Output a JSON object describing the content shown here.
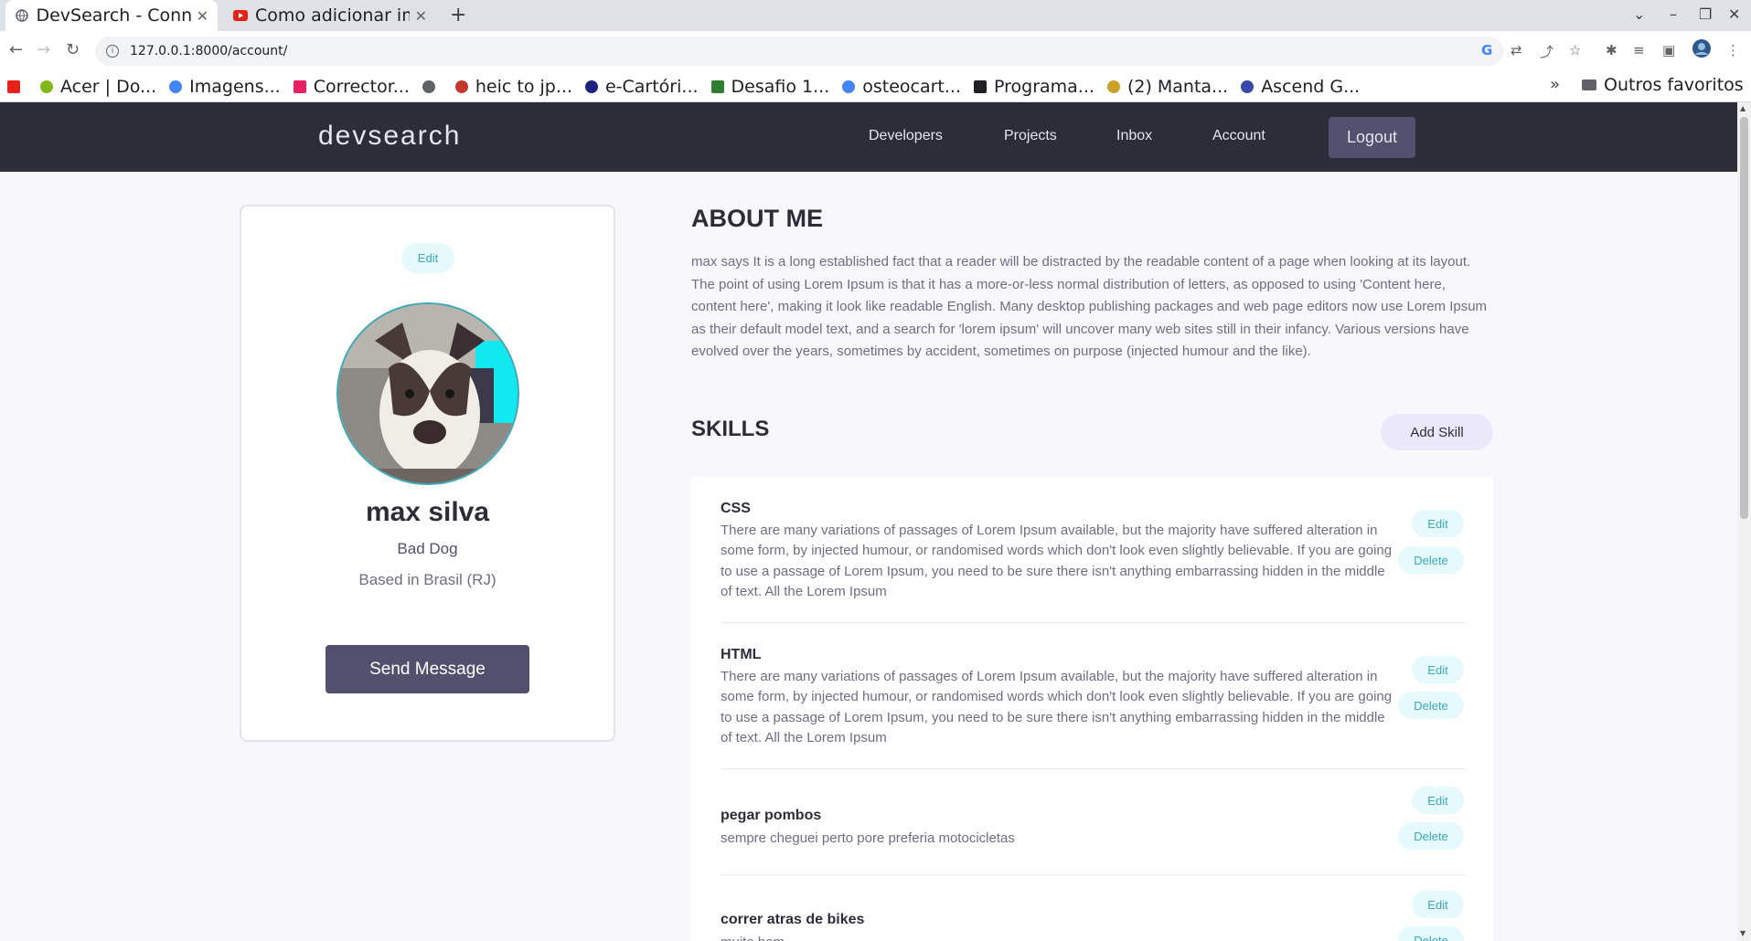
{
  "browser": {
    "tabs": [
      {
        "title": "DevSearch - Conne",
        "active": true
      },
      {
        "title": "Como adicionar im",
        "active": false
      }
    ],
    "url": "127.0.0.1:8000/account/",
    "bookmarks": [
      {
        "label": "",
        "color": "#e62117"
      },
      {
        "label": "Acer | Do...",
        "color": "#83b81a"
      },
      {
        "label": "Imagens...",
        "color": "#4285f4"
      },
      {
        "label": "Corrector...",
        "color": "#e91e63"
      },
      {
        "label": "",
        "color": "#5f6368"
      },
      {
        "label": "heic to jp...",
        "color": "#c0392b"
      },
      {
        "label": "e-Cartóri...",
        "color": "#1a237e"
      },
      {
        "label": "Desafio 1...",
        "color": "#2e7d32"
      },
      {
        "label": "osteocart...",
        "color": "#4285f4"
      },
      {
        "label": "Programa...",
        "color": "#202124"
      },
      {
        "label": "(2) Manta...",
        "color": "#c9a227"
      },
      {
        "label": "Ascend G...",
        "color": "#3949ab"
      }
    ],
    "bookmarks_more": "»",
    "other_bookmarks": "Outros favoritos"
  },
  "header": {
    "logo": "devsearch",
    "nav": [
      "Developers",
      "Projects",
      "Inbox",
      "Account"
    ],
    "logout": "Logout"
  },
  "profile": {
    "edit_label": "Edit",
    "name": "max silva",
    "short_intro": "Bad Dog",
    "location": "Based in Brasil (RJ)",
    "send_message": "Send Message"
  },
  "about": {
    "title": "ABOUT ME",
    "text": "max says It is a long established fact that a reader will be distracted by the readable content of a page when looking at its layout. The point of using Lorem Ipsum is that it has a more-or-less normal distribution of letters, as opposed to using 'Content here, content here', making it look like readable English. Many desktop publishing packages and web page editors now use Lorem Ipsum as their default model text, and a search for 'lorem ipsum' will uncover many web sites still in their infancy. Various versions have evolved over the years, sometimes by accident, sometimes on purpose (injected humour and the like)."
  },
  "skills": {
    "title": "SKILLS",
    "add_label": "Add Skill",
    "edit_label": "Edit",
    "delete_label": "Delete",
    "items": [
      {
        "name": "CSS",
        "description": "There are many variations of passages of Lorem Ipsum available, but the majority have suffered alteration in some form, by injected humour, or randomised words which don't look even slightly believable. If you are going to use a passage of Lorem Ipsum, you need to be sure there isn't anything embarrassing hidden in the middle of text. All the Lorem Ipsum"
      },
      {
        "name": "HTML",
        "description": "There are many variations of passages of Lorem Ipsum available, but the majority have suffered alteration in some form, by injected humour, or randomised words which don't look even slightly believable. If you are going to use a passage of Lorem Ipsum, you need to be sure there isn't anything embarrassing hidden in the middle of text. All the Lorem Ipsum"
      },
      {
        "name": "pegar pombos",
        "description": "sempre cheguei perto pore preferia motocicletas"
      },
      {
        "name": "correr atras de bikes",
        "description": "muito bom"
      }
    ]
  }
}
